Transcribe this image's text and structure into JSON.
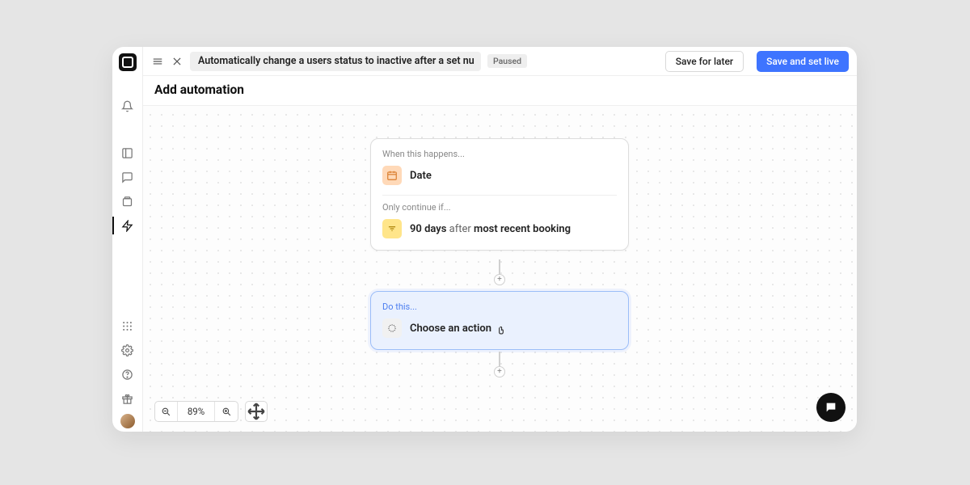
{
  "header": {
    "title_field": "Automatically change a users status to inactive after a set nu",
    "status_pill": "Paused",
    "save_for_later": "Save for later",
    "save_and_set_live": "Save and set live"
  },
  "subheader": "Add automation",
  "trigger_node": {
    "section_label": "When this happens...",
    "trigger_text": "Date",
    "condition_label": "Only continue if...",
    "condition_bold_a": "90 days",
    "condition_light": " after ",
    "condition_bold_b": "most recent booking"
  },
  "action_node": {
    "section_label": "Do this...",
    "choose_text": "Choose an action"
  },
  "zoom": {
    "level": "89%"
  }
}
